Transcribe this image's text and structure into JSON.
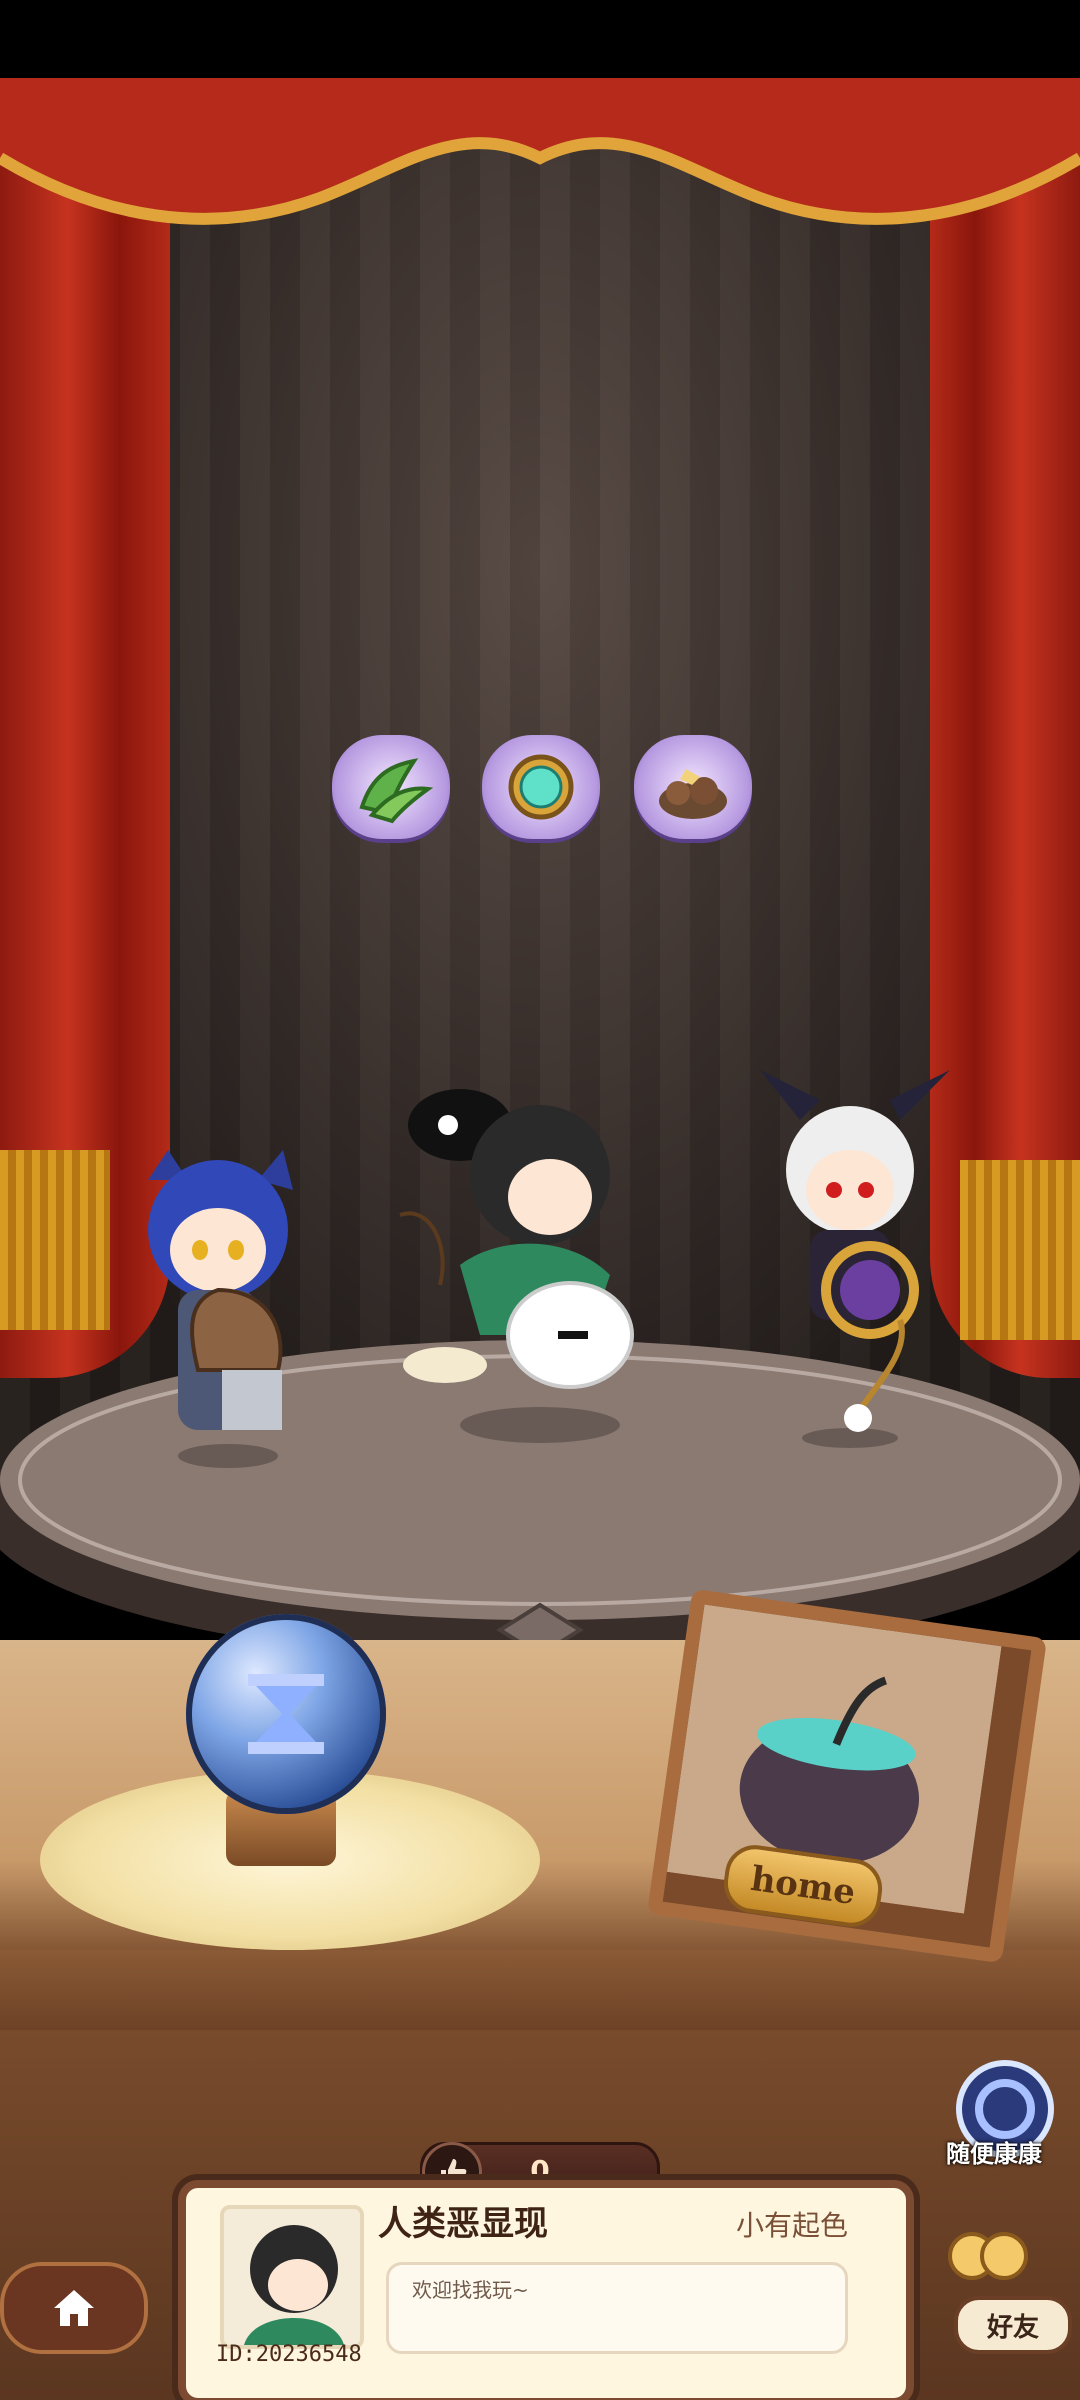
{
  "items": [
    "herb-item-icon",
    "jade-mirror-item-icon",
    "mud-clod-item-icon"
  ],
  "home_sign": "home",
  "likes": {
    "icon": "thumbs-up-icon",
    "count": "0"
  },
  "player": {
    "name": "人类恶显现",
    "rank": "小有起色",
    "message": "欢迎找我玩~",
    "id": "ID:20236548"
  },
  "buttons": {
    "random_visit": "随便康康",
    "friends": "好友",
    "home": "home-icon"
  },
  "colors": {
    "curtain": "#c6331f",
    "fringe": "#d79b24",
    "wood": "#7b4a30",
    "card_bg": "#fff6e0"
  }
}
